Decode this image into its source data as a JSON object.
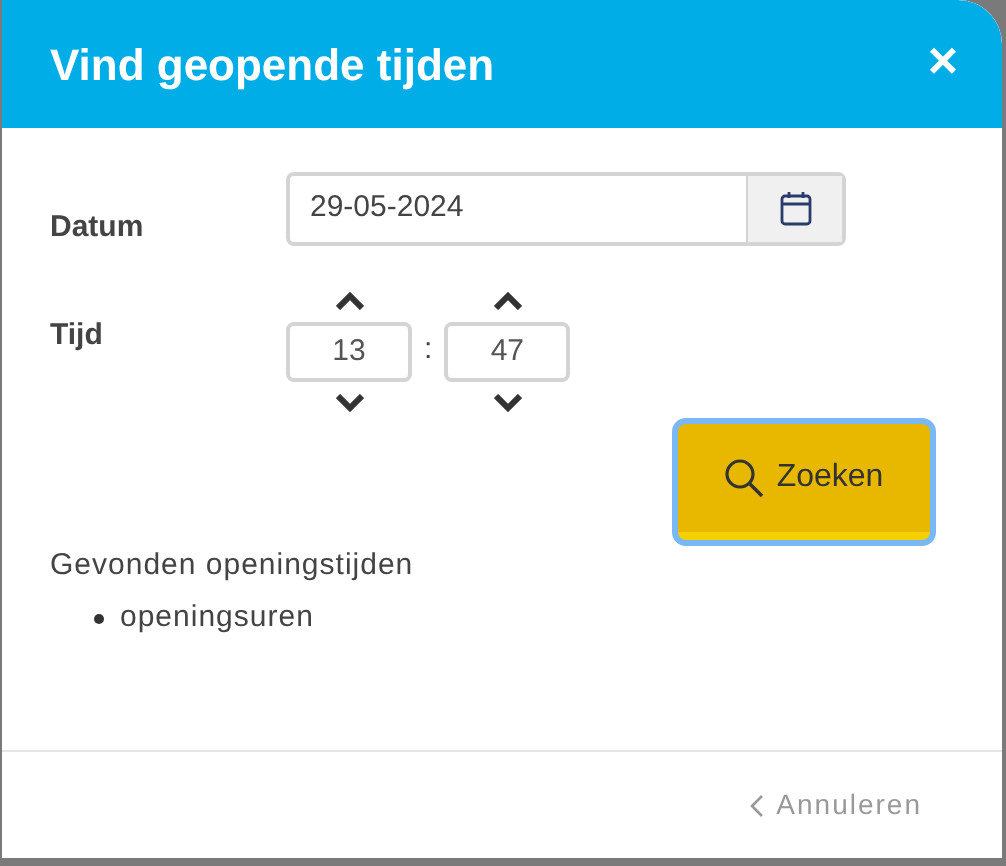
{
  "dialog": {
    "title": "Vind geopende tijden",
    "close": "×"
  },
  "date": {
    "label": "Datum",
    "value": "29-05-2024"
  },
  "time": {
    "label": "Tijd",
    "hours": "13",
    "separator": ":",
    "minutes": "47"
  },
  "search_button": {
    "label": "Zoeken",
    "focused": true
  },
  "results": {
    "heading": "Gevonden openingstijden",
    "items": [
      "openingsuren"
    ]
  },
  "footer": {
    "cancel": "Annuleren"
  }
}
